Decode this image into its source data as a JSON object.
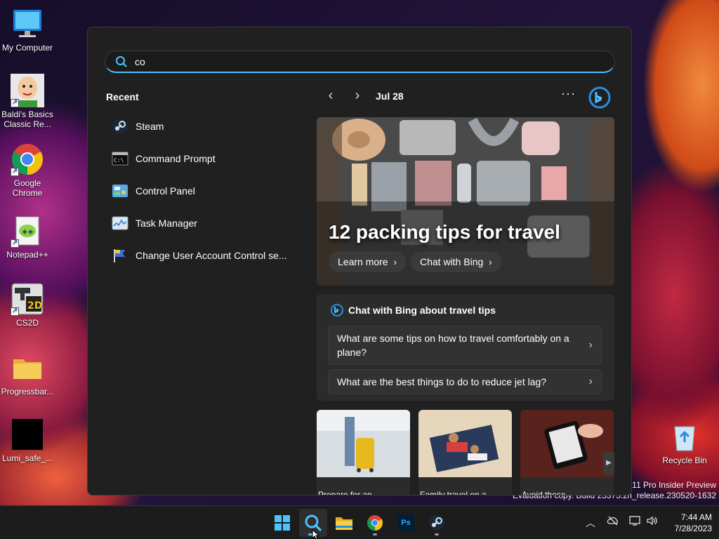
{
  "desktop": {
    "icons": [
      {
        "label": "My Computer"
      },
      {
        "label": "Baldi's Basics Classic Re..."
      },
      {
        "label": "Google Chrome"
      },
      {
        "label": "Notepad++"
      },
      {
        "label": "CS2D"
      },
      {
        "label": "Progressbar..."
      },
      {
        "label": "Lumi_safe_..."
      },
      {
        "label": "Recycle Bin"
      }
    ],
    "watermark_line1": "s 11 Pro Insider Preview",
    "watermark_line2": "Evaluation copy. Build 25375.zn_release.230520-1632"
  },
  "search": {
    "value": "co",
    "placeholder": ""
  },
  "recent": {
    "title": "Recent",
    "items": [
      {
        "label": "Steam",
        "icon": "steam-icon"
      },
      {
        "label": "Command Prompt",
        "icon": "command-prompt-icon"
      },
      {
        "label": "Control Panel",
        "icon": "control-panel-icon"
      },
      {
        "label": "Task Manager",
        "icon": "task-manager-icon"
      },
      {
        "label": "Change User Account Control se...",
        "icon": "uac-flag-icon"
      }
    ]
  },
  "feed": {
    "date": "Jul 28",
    "more": "···",
    "hero": {
      "title": "12 packing tips for travel",
      "learn_more": "Learn more",
      "chat_with_bing": "Chat with Bing"
    },
    "chat": {
      "title": "Chat with Bing about travel tips",
      "questions": [
        "What are some tips on how to travel comfortably on a plane?",
        "What are the best things to do to reduce jet lag?"
      ]
    },
    "thumbnails": [
      {
        "caption": "Prepare for an"
      },
      {
        "caption": "Family travel on a"
      },
      {
        "caption": "Avoid these"
      }
    ]
  },
  "taskbar": {
    "apps": [
      "start-icon",
      "search-icon",
      "file-explorer-icon",
      "chrome-icon",
      "photoshop-icon",
      "steam-icon"
    ],
    "photoshop_label": "Ps",
    "clock_time": "7:44 AM",
    "clock_date": "7/28/2023"
  },
  "colors": {
    "accent": "#4cc2ff",
    "panel": "#202020",
    "card": "#2b2b2b"
  }
}
